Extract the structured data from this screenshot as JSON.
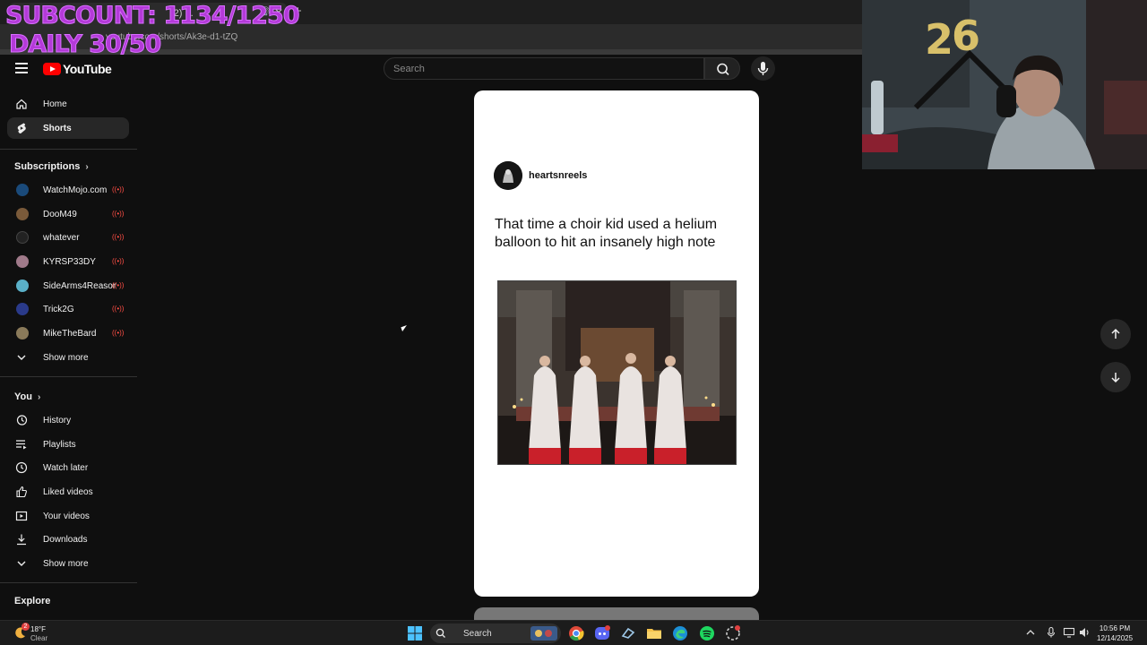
{
  "overlay": {
    "line1": "SUBCOUNT: 1134/1250",
    "line2": "DAILY 30/50"
  },
  "browser": {
    "tab_title": "(2) ...",
    "url": "youtube.com/shorts/Ak3e-d1-tZQ",
    "new_tab": "+",
    "close": "✕",
    "mute": "🔊"
  },
  "header": {
    "logo_text": "YouTube",
    "search_placeholder": "Search"
  },
  "sidebar": {
    "main": [
      {
        "label": "Home",
        "icon": "home-icon"
      },
      {
        "label": "Shorts",
        "icon": "shorts-icon",
        "active": true
      }
    ],
    "subscriptions_header": "Subscriptions",
    "subscriptions": [
      {
        "label": "WatchMojo.com",
        "color": "#1a4a7a"
      },
      {
        "label": "DooM49",
        "color": "#7a5a3a"
      },
      {
        "label": "whatever",
        "color": "#222222"
      },
      {
        "label": "KYRSP33DY",
        "color": "#a07a8a"
      },
      {
        "label": "SideArms4Reason",
        "color": "#5ab0c8"
      },
      {
        "label": "Trick2G",
        "color": "#2a3a8a"
      },
      {
        "label": "MikeTheBard",
        "color": "#8a7a5a"
      }
    ],
    "subs_show_more": "Show more",
    "you_header": "You",
    "you": [
      {
        "label": "History",
        "icon": "history-icon"
      },
      {
        "label": "Playlists",
        "icon": "playlists-icon"
      },
      {
        "label": "Watch later",
        "icon": "watch-later-icon"
      },
      {
        "label": "Liked videos",
        "icon": "liked-icon"
      },
      {
        "label": "Your videos",
        "icon": "your-videos-icon"
      },
      {
        "label": "Downloads",
        "icon": "downloads-icon"
      }
    ],
    "you_show_more": "Show more",
    "explore_header": "Explore"
  },
  "short": {
    "channel": "heartsnreels",
    "title": "That time a choir kid used a helium balloon to hit an insanely high note"
  },
  "taskbar": {
    "temperature": "18°F",
    "condition": "Clear",
    "search_label": "Search",
    "time": "10:56 PM",
    "date": "12/14/2025",
    "badge": "2"
  },
  "colors": {
    "youtube_red": "#ff0000",
    "overlay_purple": "#b43ad9",
    "background": "#0f0f0f"
  }
}
